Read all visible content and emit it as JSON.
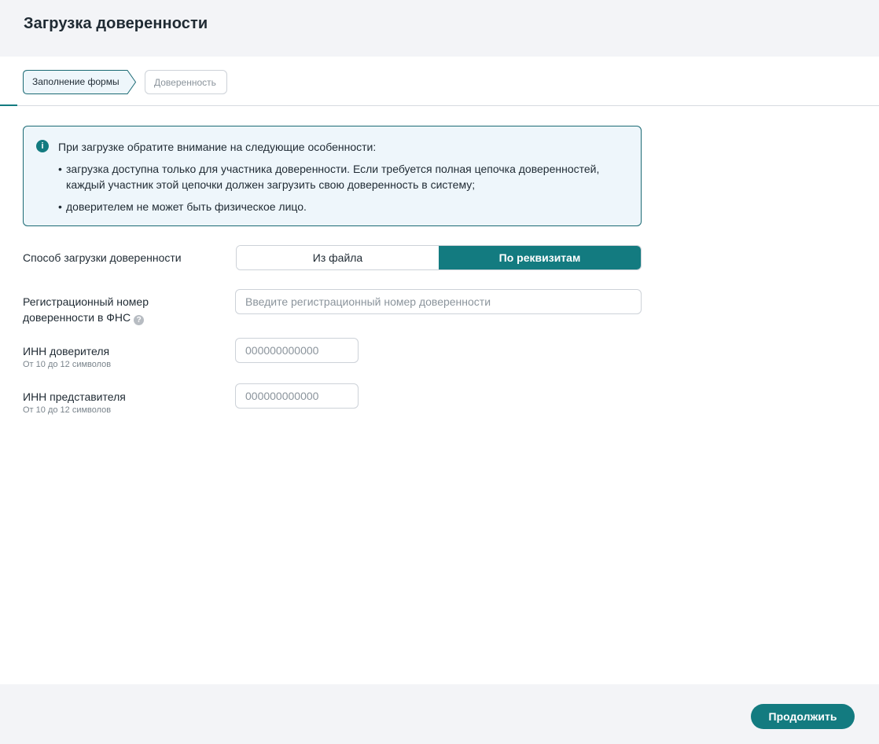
{
  "header": {
    "title": "Загрузка доверенности"
  },
  "steps": [
    {
      "label": "Заполнение формы",
      "state": "active"
    },
    {
      "label": "Доверенность",
      "state": "inactive"
    }
  ],
  "info": {
    "icon": "info-icon",
    "title": "При загрузке обратите внимание на следующие особенности:",
    "bullets": [
      "загрузка доступна только для участника доверенности. Если требуется полная цепочка доверенностей, каждый участник этой цепочки должен загрузить свою доверенность в систему;",
      "доверителем не может быть физическое лицо."
    ]
  },
  "form": {
    "method": {
      "label": "Способ загрузки доверенности",
      "options": [
        "Из файла",
        "По реквизитам"
      ],
      "selected": "По реквизитам"
    },
    "reg_number": {
      "label_line1": "Регистрационный номер",
      "label_line2": "доверенности в ФНС",
      "help_icon": "?",
      "placeholder": "Введите регистрационный номер доверенности",
      "value": ""
    },
    "principal_inn": {
      "label": "ИНН доверителя",
      "hint": "От 10 до 12 символов",
      "placeholder": "000000000000",
      "value": ""
    },
    "representative_inn": {
      "label": "ИНН представителя",
      "hint": "От 10 до 12 символов",
      "placeholder": "000000000000",
      "value": ""
    }
  },
  "footer": {
    "continue_label": "Продолжить"
  },
  "colors": {
    "accent": "#137b80",
    "header_bg": "#f3f4f7",
    "info_bg": "#eef6fb"
  }
}
